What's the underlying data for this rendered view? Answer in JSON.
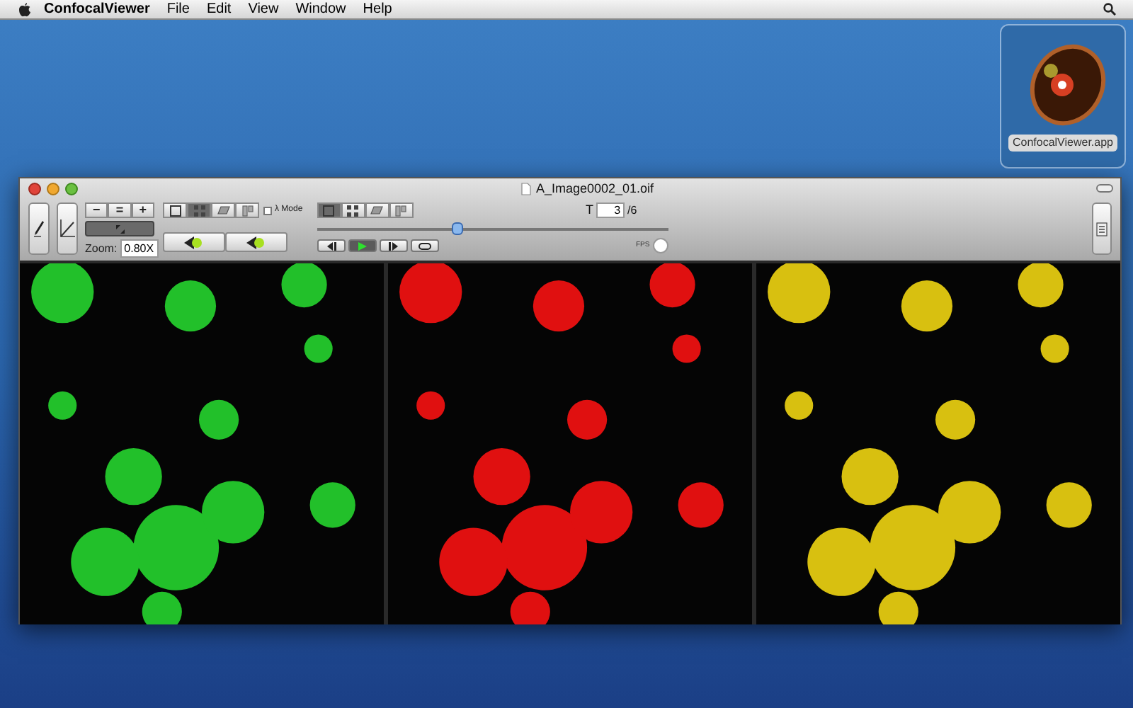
{
  "menu_bar": {
    "app_name": "ConfocalViewer",
    "menus": [
      "File",
      "Edit",
      "View",
      "Window",
      "Help"
    ]
  },
  "desktop_icon": {
    "label": "ConfocalViewer.app"
  },
  "window": {
    "title": "A_Image0002_01.oif"
  },
  "toolbar": {
    "step_buttons": [
      "−",
      "=",
      "+"
    ],
    "zoom_label": "Zoom:",
    "zoom_value": "0.80X",
    "layout_buttons": [
      {
        "selected": false
      },
      {
        "selected": true
      },
      {
        "selected": false
      },
      {
        "selected": false
      }
    ],
    "lambda_mode": {
      "label": "λ Mode",
      "checked": false
    },
    "view_buttons": [
      {
        "selected": true
      },
      {
        "selected": false
      },
      {
        "selected": false
      },
      {
        "selected": false
      }
    ],
    "time_slider": {
      "level": 0.4
    },
    "playback_buttons": [
      {
        "kind": "back",
        "selected": false
      },
      {
        "kind": "play",
        "selected": true
      },
      {
        "kind": "forward",
        "selected": false
      },
      {
        "kind": "loop",
        "selected": false
      }
    ],
    "t_label": "T",
    "t_value": "3",
    "t_total": "/6",
    "fps_label": "FPS"
  },
  "channels": [
    {
      "color": "#22c02a"
    },
    {
      "color": "#e01010"
    },
    {
      "color": "#d8c010"
    }
  ]
}
